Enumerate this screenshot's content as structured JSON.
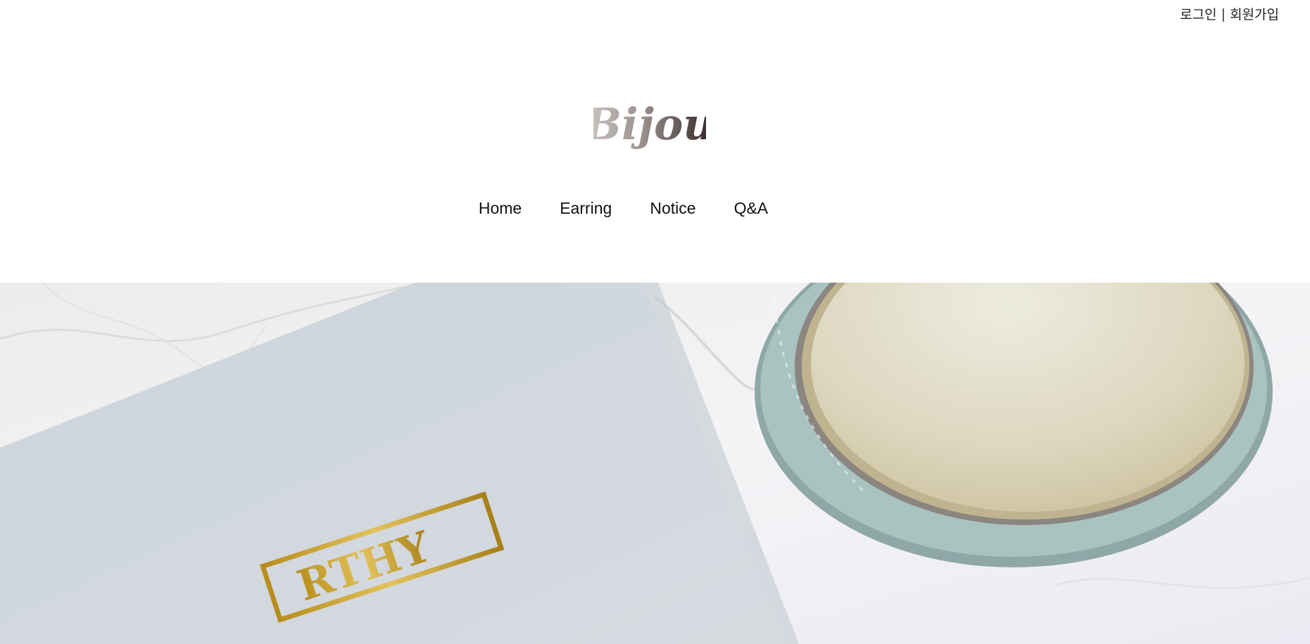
{
  "header": {
    "auth": {
      "login_label": "로그인",
      "separator": "|",
      "signup_label": "회원가입"
    },
    "logo_text": "Bijou"
  },
  "nav": {
    "items": [
      {
        "label": "Home"
      },
      {
        "label": "Earring"
      },
      {
        "label": "Notice"
      },
      {
        "label": "Q&A"
      }
    ]
  },
  "hero": {
    "box_print": "RTHY"
  },
  "colors": {
    "background": "#ffffff",
    "text": "#111111",
    "logo_light": "#bfb8b4",
    "logo_dark": "#3b2f2c",
    "box_blue": "#cdd5dc",
    "marble": "#e9e9ec",
    "gold": "#c9a227",
    "tin_teal": "#9fbfbd",
    "tin_inner": "#d8d3bf"
  }
}
